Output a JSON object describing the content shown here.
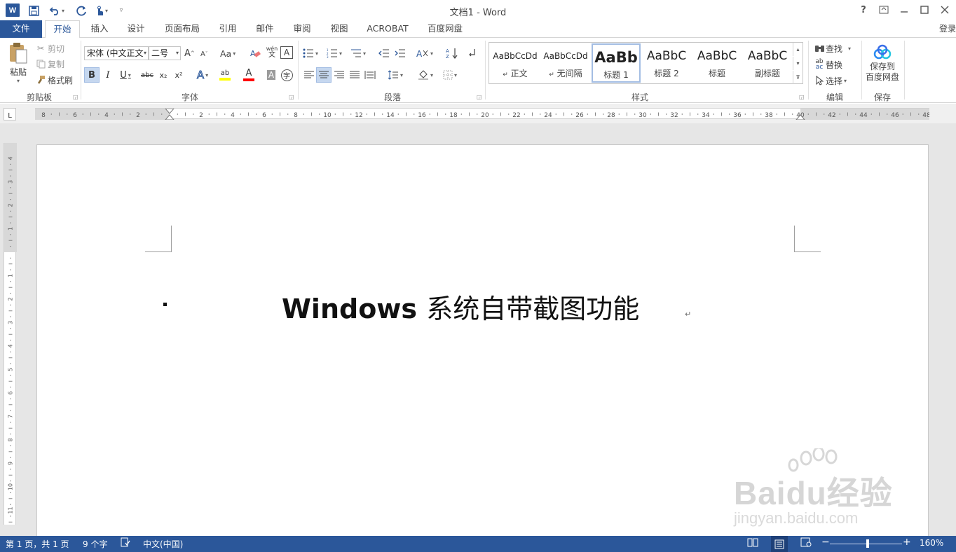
{
  "titlebar": {
    "logo": "W",
    "title": "文档1 - Word",
    "help": "?",
    "quick_access": [
      "save-icon",
      "undo-icon",
      "redo-icon",
      "touch-mode-icon",
      "customize-icon"
    ]
  },
  "tabs": [
    {
      "label": "文件",
      "active": false
    },
    {
      "label": "开始",
      "active": true
    },
    {
      "label": "插入"
    },
    {
      "label": "设计"
    },
    {
      "label": "页面布局"
    },
    {
      "label": "引用"
    },
    {
      "label": "邮件"
    },
    {
      "label": "审阅"
    },
    {
      "label": "视图"
    },
    {
      "label": "ACROBAT"
    },
    {
      "label": "百度网盘"
    }
  ],
  "login": "登录",
  "clipboard": {
    "paste": "粘贴",
    "cut": "剪切",
    "copy": "复制",
    "format_painter": "格式刷",
    "group": "剪贴板"
  },
  "font": {
    "font_name": "宋体 (中文正文",
    "font_size": "二号",
    "group": "字体",
    "bold": "B",
    "italic": "I",
    "underline": "U",
    "strike": "abc",
    "sub": "x₂",
    "sup": "x²",
    "change_case": "Aa",
    "grow": "A",
    "shrink": "A",
    "phonetic": "wén",
    "char_border": "A",
    "font_color": "A",
    "char_shading": "A",
    "enclose": "字"
  },
  "paragraph": {
    "group": "段落"
  },
  "styles": {
    "group": "样式",
    "items": [
      {
        "sample": "AaBbCcDd",
        "name": "正文",
        "marker": "↵"
      },
      {
        "sample": "AaBbCcDd",
        "name": "无间隔",
        "marker": "↵"
      },
      {
        "sample": "AaBb",
        "name": "标题 1",
        "selected": true
      },
      {
        "sample": "AaBbC",
        "name": "标题 2"
      },
      {
        "sample": "AaBbC",
        "name": "标题"
      },
      {
        "sample": "AaBbC",
        "name": "副标题"
      }
    ]
  },
  "editing": {
    "find": "查找",
    "replace": "替换",
    "select": "选择",
    "group": "编辑"
  },
  "save_baidu": {
    "label_line1": "保存到",
    "label_line2": "百度网盘",
    "group": "保存"
  },
  "ruler": {
    "selector": "L",
    "h_labels": [
      "8",
      "6",
      "4",
      "2",
      "",
      "2",
      "4",
      "6",
      "8",
      "10",
      "12",
      "14",
      "16",
      "18",
      "20",
      "22",
      "24",
      "26",
      "28",
      "30",
      "32",
      "34",
      "36",
      "38",
      "40",
      "42",
      "44",
      "46",
      "48"
    ],
    "v_labels": [
      "4",
      "3",
      "2",
      "1",
      "",
      "1",
      "2",
      "3",
      "4",
      "5",
      "6",
      "7",
      "8",
      "9",
      "10",
      "11"
    ]
  },
  "document": {
    "heading_latin": "Windows",
    "heading_cn": "系统自带截图功能",
    "para_mark": "↵"
  },
  "watermark": {
    "brand": "Baidu经验",
    "url": "jingyan.baidu.com"
  },
  "status": {
    "page": "第 1 页，共 1 页",
    "words": "9 个字",
    "language": "中文(中国)",
    "zoom": "160%",
    "zoom_level": 0.52,
    "zoom_minus": "−",
    "zoom_plus": "+"
  },
  "colors": {
    "accent": "#2b579a",
    "highlight": "#ffff00",
    "font_color": "#ff0000"
  }
}
